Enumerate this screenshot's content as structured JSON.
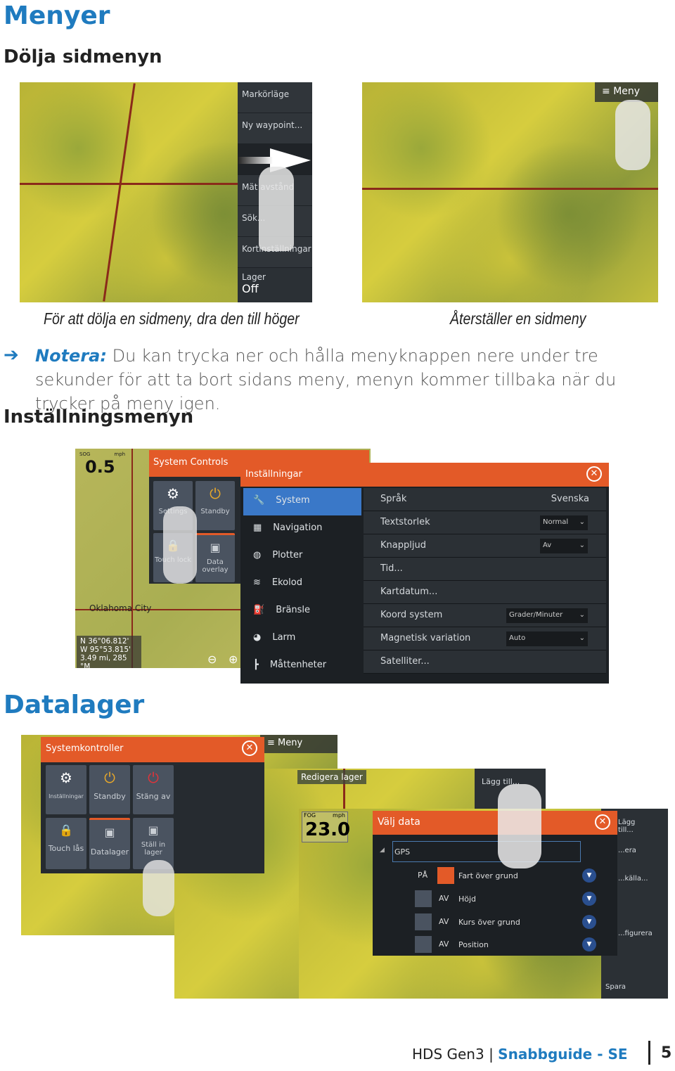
{
  "headings": {
    "menyer": "Menyer",
    "dolja": "Dölja sidmenyn",
    "installningsmenyn": "Inställningsmenyn",
    "datalager": "Datalager"
  },
  "fig1": {
    "menu": [
      "Markörläge",
      "Ny waypoint...",
      "",
      "Mät avstånd",
      "Sök...",
      "Kortinställningar"
    ],
    "lager_label": "Lager",
    "lager_value": "Off",
    "caption": "För att dölja en sidmeny, dra den till höger"
  },
  "fig2": {
    "menu_button": "Meny",
    "caption": "Återställer en sidmeny"
  },
  "note": {
    "label": "Notera:",
    "text": " Du kan trycka ner och hålla menyknappen nere under tre sekunder för att ta bort sidans meny, menyn kommer tillbaka när du trycker på meny igen."
  },
  "fig3": {
    "sog_label": "SOG",
    "unit": "mph",
    "speed": "0.5",
    "city": "Oklahoma City",
    "position": [
      "N  36°06.812'",
      "W  95°53.815'",
      "3.49 mi, 285 °M"
    ],
    "system_controls": {
      "title": "System Controls",
      "tiles": [
        "Settings",
        "Standby",
        "Touch lock",
        "Data overlay"
      ]
    },
    "settings": {
      "title": "Inställningar",
      "nav": [
        {
          "label": "System",
          "icon": "wrench-icon"
        },
        {
          "label": "Navigation",
          "icon": "calculator-icon"
        },
        {
          "label": "Plotter",
          "icon": "globe-icon"
        },
        {
          "label": "Ekolod",
          "icon": "sonar-icon"
        },
        {
          "label": "Bränsle",
          "icon": "fuel-icon"
        },
        {
          "label": "Larm",
          "icon": "alarm-icon"
        },
        {
          "label": "Måttenheter",
          "icon": "ruler-icon"
        }
      ],
      "rows": [
        {
          "label": "Språk",
          "value": "Svenska"
        },
        {
          "label": "Textstorlek",
          "value": "Normal"
        },
        {
          "label": "Knappljud",
          "value": "Av"
        },
        {
          "label": "Tid..."
        },
        {
          "label": "Kartdatum..."
        },
        {
          "label": "Koord system",
          "value": "Grader/Minuter"
        },
        {
          "label": "Magnetisk variation",
          "value": "Auto"
        },
        {
          "label": "Satelliter..."
        }
      ]
    }
  },
  "fig4": {
    "system_controls": {
      "title": "Systemkontroller",
      "tiles": [
        "Inställningar",
        "Standby",
        "Stäng av",
        "Touch lås",
        "Datalager",
        "Ställ in lager"
      ]
    },
    "menu_button": "Meny",
    "edit_layer": "Redigera lager",
    "fog": "FOG",
    "unit": "mph",
    "speed": "23.0",
    "side_menu": [
      "Lägg till...",
      "Lägg till...",
      "...era",
      "...källa...",
      "...figurera",
      "Spara"
    ],
    "dialog": {
      "title": "Välj data",
      "group": "GPS",
      "items": [
        {
          "state": "PÅ",
          "label": "Fart över grund",
          "on": true
        },
        {
          "state": "AV",
          "label": "Höjd",
          "on": false
        },
        {
          "state": "AV",
          "label": "Kurs över grund",
          "on": false
        },
        {
          "state": "AV",
          "label": "Position",
          "on": false
        }
      ]
    }
  },
  "footer": {
    "product": "HDS Gen3",
    "separator": "|",
    "guide": "Snabbguide - SE",
    "page": "5"
  },
  "colors": {
    "heading": "#1f7bbf",
    "accent": "#e35a28",
    "selected": "#3a78c8"
  }
}
